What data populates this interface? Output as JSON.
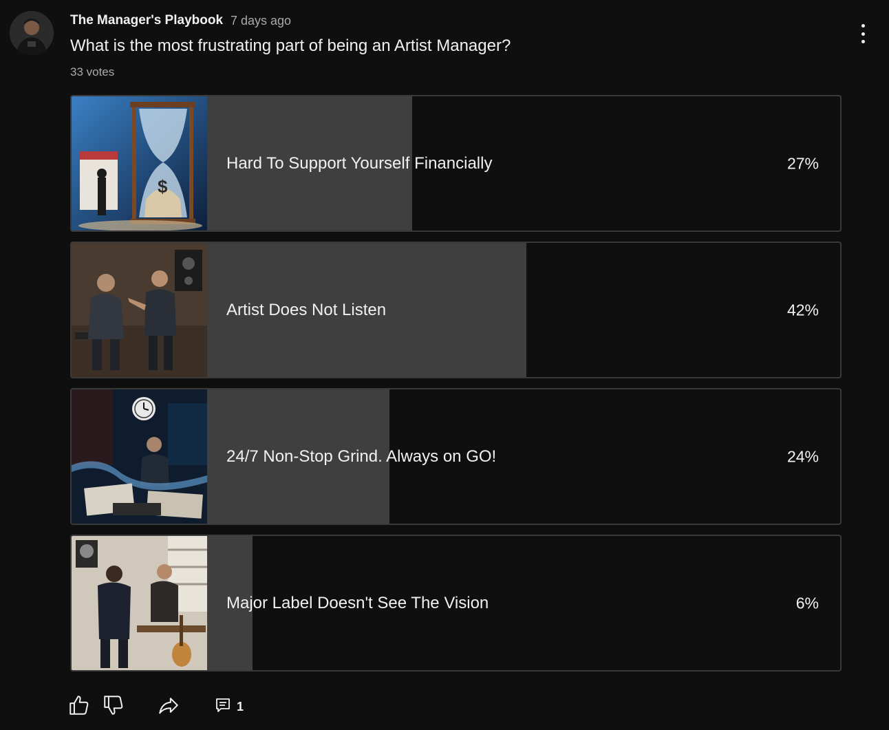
{
  "post": {
    "channel_name": "The Manager's Playbook",
    "posted_time": "7 days ago",
    "question": "What is the most frustrating part of being an Artist Manager?",
    "votes_label": "33 votes"
  },
  "poll": {
    "options": [
      {
        "label": "Hard To Support Yourself Financially",
        "percent_label": "27%",
        "percent": 27,
        "image": "hourglass-money-illustration"
      },
      {
        "label": "Artist Does Not Listen",
        "percent_label": "42%",
        "percent": 42,
        "image": "manager-arguing-with-artist-illustration"
      },
      {
        "label": "24/7 Non-Stop Grind. Always on GO!",
        "percent_label": "24%",
        "percent": 24,
        "image": "overworked-manager-clock-illustration"
      },
      {
        "label": "Major Label Doesn't See The Vision",
        "percent_label": "6%",
        "percent": 6,
        "image": "label-meeting-guitar-illustration"
      }
    ]
  },
  "actions": {
    "comment_count": "1",
    "icons": [
      "thumbs-up-icon",
      "thumbs-down-icon",
      "share-icon",
      "comment-icon",
      "more-vert-icon"
    ]
  },
  "colors": {
    "background": "#0f0f0f",
    "bar_fill": "#3f3f3f",
    "border": "#3a3a3a",
    "text_primary": "#f1f1f1",
    "text_secondary": "#aaaaaa"
  }
}
